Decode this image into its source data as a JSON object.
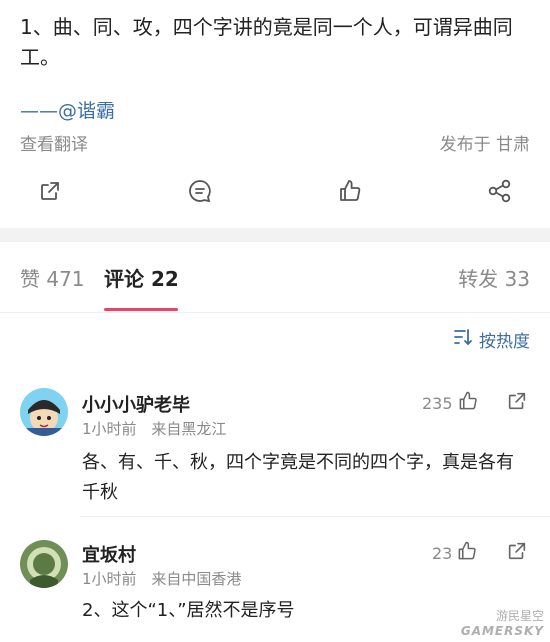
{
  "post": {
    "text": "1、曲、同、攻，四个字讲的竟是同一个人，可谓异曲同工。",
    "signature": "——@谐霸",
    "translate_label": "查看翻译",
    "location": "发布于 甘肃"
  },
  "actions": {
    "share_icon": "share-external-icon",
    "comment_icon": "comment-icon",
    "like_icon": "thumbs-up-icon",
    "forward_icon": "share-nodes-icon"
  },
  "tabs": {
    "likes": "赞 471",
    "comments": "评论 22",
    "reposts": "转发 33"
  },
  "sort": {
    "label": "按热度"
  },
  "comments": [
    {
      "name": "小小小驴老毕",
      "time": "1小时前",
      "source": "来自黑龙江",
      "likes": "235",
      "text": "各、有、千、秋，四个字竟是不同的四个字，真是各有千秋"
    },
    {
      "name": "宜坂村",
      "time": "1小时前",
      "source": "来自中国香港",
      "likes": "23",
      "text": "2、这个“1、”居然不是序号"
    }
  ],
  "watermark": {
    "line1": "游民星空",
    "line2": "GAMERSKY"
  },
  "colors": {
    "accent": "#3b6ea5",
    "tab_underline": "#e8456b",
    "muted": "#8a8a8a"
  }
}
